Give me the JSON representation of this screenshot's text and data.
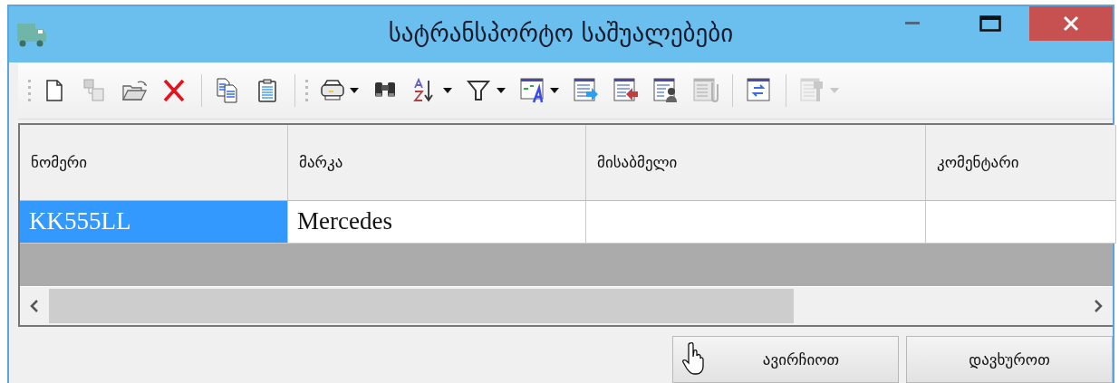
{
  "window": {
    "title": "სატრანსპორტო საშუალებები"
  },
  "toolbar": {
    "groups": [
      {
        "buttons": [
          {
            "kind": "new",
            "disabled": false,
            "dropdown": false
          },
          {
            "kind": "duplicate",
            "disabled": true,
            "dropdown": false
          },
          {
            "kind": "open",
            "disabled": false,
            "dropdown": false
          },
          {
            "kind": "delete",
            "disabled": false,
            "dropdown": false
          },
          {
            "kind": "sep"
          },
          {
            "kind": "copy",
            "disabled": false,
            "dropdown": false
          },
          {
            "kind": "paste",
            "disabled": false,
            "dropdown": false
          }
        ]
      },
      {
        "buttons": [
          {
            "kind": "print",
            "disabled": false,
            "dropdown": true
          },
          {
            "kind": "find",
            "disabled": false,
            "dropdown": false
          },
          {
            "kind": "sort",
            "disabled": false,
            "dropdown": true
          },
          {
            "kind": "filter",
            "disabled": false,
            "dropdown": true
          },
          {
            "kind": "format",
            "disabled": false,
            "dropdown": true
          },
          {
            "kind": "export",
            "disabled": false,
            "dropdown": false
          },
          {
            "kind": "import",
            "disabled": false,
            "dropdown": false
          },
          {
            "kind": "user",
            "disabled": false,
            "dropdown": false
          },
          {
            "kind": "attach",
            "disabled": true,
            "dropdown": false
          },
          {
            "kind": "sep"
          },
          {
            "kind": "refresh",
            "disabled": false,
            "dropdown": false
          },
          {
            "kind": "sep"
          },
          {
            "kind": "settings",
            "disabled": true,
            "dropdown": true
          }
        ]
      }
    ]
  },
  "table": {
    "columns": [
      "ნომერი",
      "მარკა",
      "მისაბმელი",
      "კომენტარი"
    ],
    "rows": [
      {
        "cells": [
          {
            "text": "KK555LL",
            "selected": true
          },
          {
            "text": "Mercedes",
            "selected": false
          },
          {
            "selected": false
          },
          {
            "selected": false
          }
        ]
      }
    ]
  },
  "buttons": [
    "ავირჩიოთ",
    "დავხუროთ"
  ]
}
